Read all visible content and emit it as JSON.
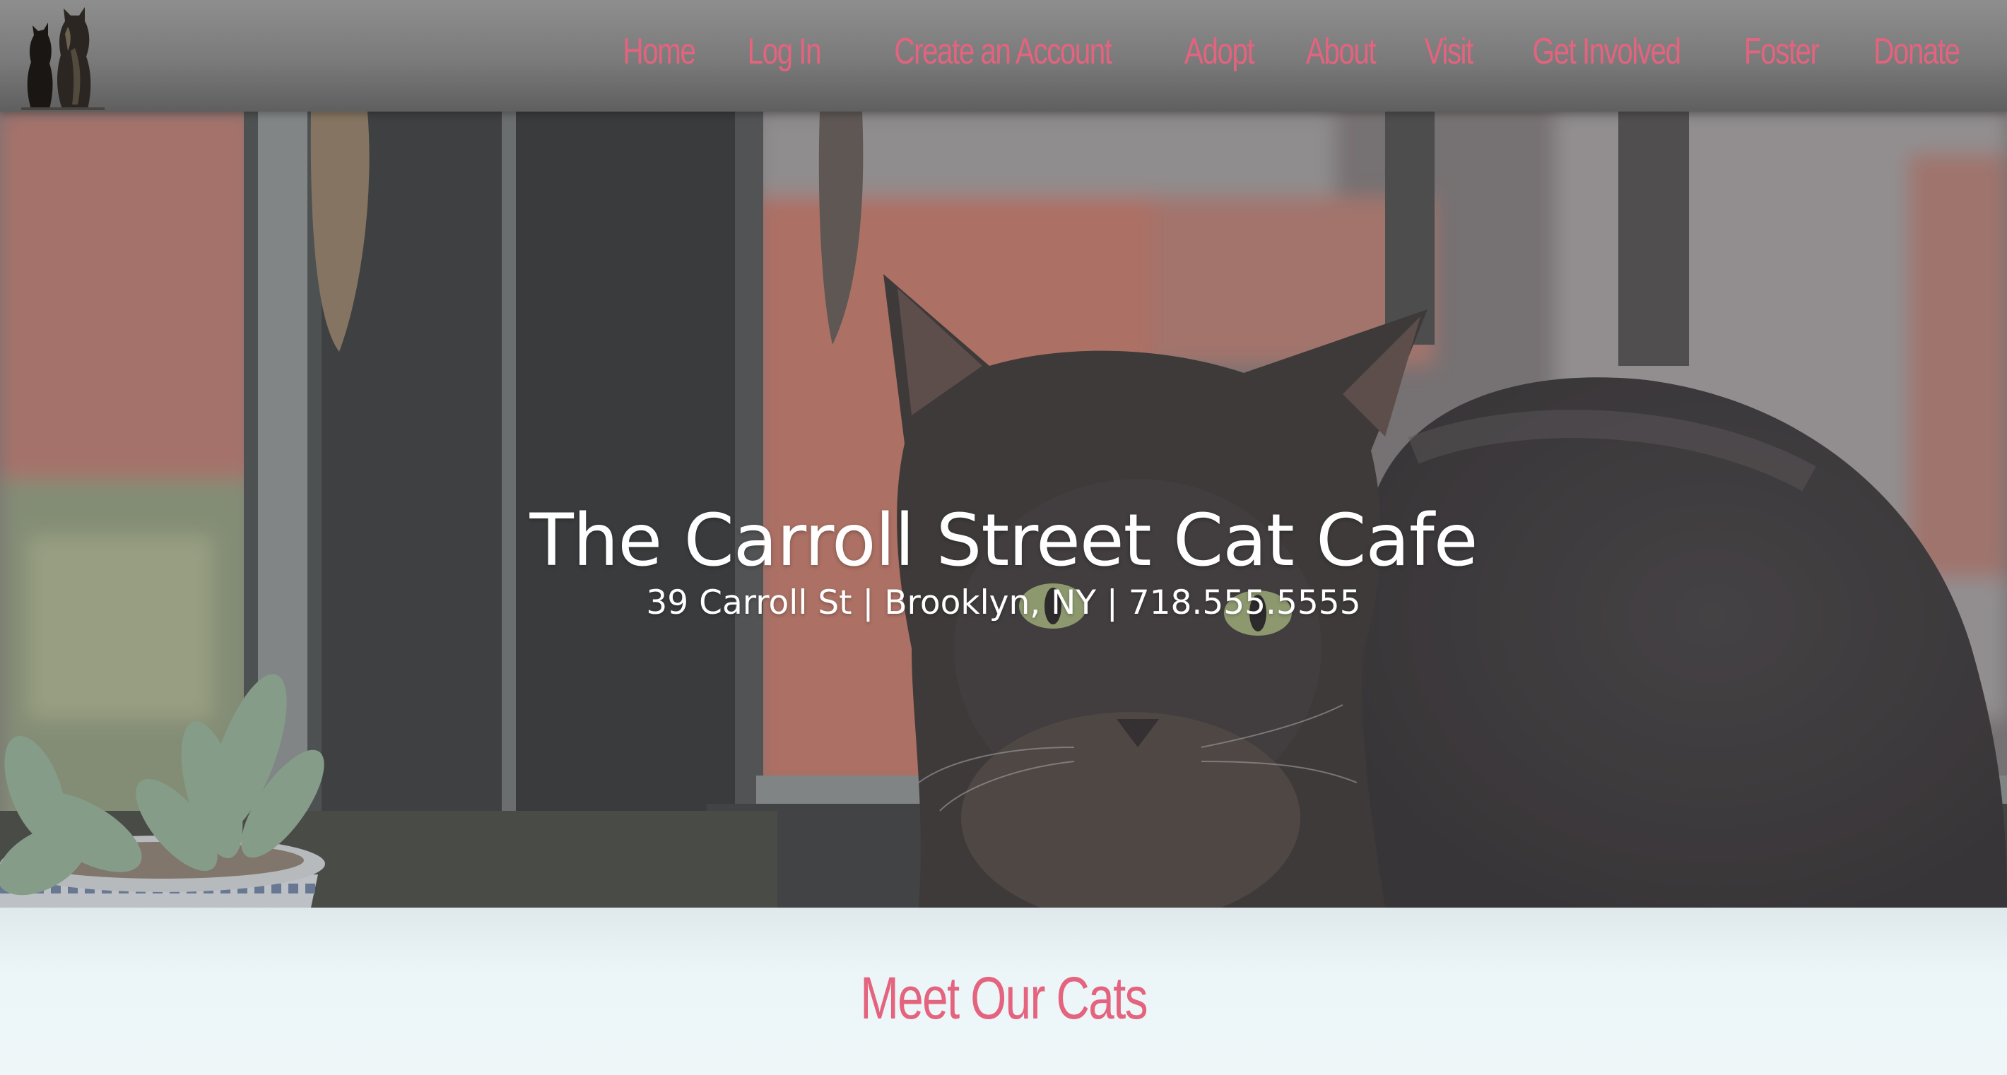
{
  "colors": {
    "accent": "#e4637e",
    "header_bg": "#7a7a7a",
    "text_light": "#ffffff"
  },
  "header": {
    "logo_icon": "two-cats-silhouette-icon",
    "nav": [
      {
        "label": "Home"
      },
      {
        "label": "Log In"
      },
      {
        "label": "Create an Account"
      },
      {
        "label": "Adopt"
      },
      {
        "label": "About"
      },
      {
        "label": "Visit"
      },
      {
        "label": "Get Involved"
      },
      {
        "label": "Foster"
      },
      {
        "label": "Donate"
      }
    ]
  },
  "hero": {
    "title": "The Carroll Street Cat Cafe",
    "subtitle": "39 Carroll St | Brooklyn, NY | 718.555.5555"
  },
  "section": {
    "title": "Meet Our Cats"
  }
}
